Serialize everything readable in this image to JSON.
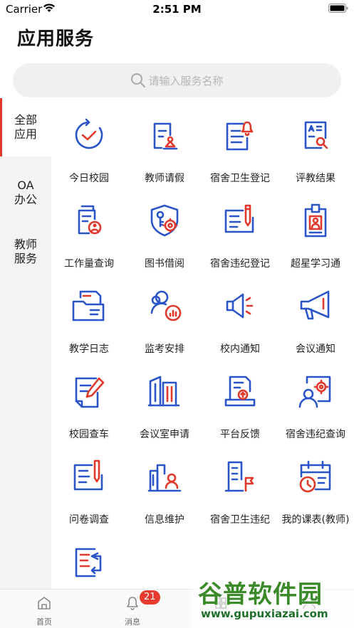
{
  "status_bar": {
    "carrier": "Carrier",
    "time": "2:51 PM"
  },
  "page_title": "应用服务",
  "search": {
    "placeholder": "请输入服务名称"
  },
  "sidebar": {
    "items": [
      {
        "label": "全部\n应用",
        "active": true
      },
      {
        "label": "OA\n办公",
        "active": false
      },
      {
        "label": "教师\n服务",
        "active": false
      }
    ]
  },
  "services": [
    {
      "label": "今日校园",
      "icon": "clock-check-icon"
    },
    {
      "label": "教师请假",
      "icon": "leave-request-icon"
    },
    {
      "label": "宿舍卫生登记",
      "icon": "hygiene-bell-icon"
    },
    {
      "label": "评教结果",
      "icon": "evaluation-result-icon"
    },
    {
      "label": "工作量查询",
      "icon": "workload-files-icon"
    },
    {
      "label": "图书借阅",
      "icon": "book-key-shield-icon"
    },
    {
      "label": "宿舍违纪登记",
      "icon": "discipline-pen-icon"
    },
    {
      "label": "超星学习通",
      "icon": "id-badge-icon"
    },
    {
      "label": "教学日志",
      "icon": "folder-log-icon"
    },
    {
      "label": "监考安排",
      "icon": "proctor-users-icon"
    },
    {
      "label": "校内通知",
      "icon": "speaker-icon"
    },
    {
      "label": "会议通知",
      "icon": "megaphone-icon"
    },
    {
      "label": "校园查车",
      "icon": "edit-document-icon"
    },
    {
      "label": "会议室申请",
      "icon": "buildings-icon"
    },
    {
      "label": "平台反馈",
      "icon": "feedback-upload-icon"
    },
    {
      "label": "宿舍违纪查询",
      "icon": "user-gear-icon"
    },
    {
      "label": "问卷调查",
      "icon": "questionnaire-icon"
    },
    {
      "label": "信息维护",
      "icon": "city-user-icon"
    },
    {
      "label": "宿舍卫生违纪",
      "icon": "building-flag-icon"
    },
    {
      "label": "我的课表(教师)",
      "icon": "calendar-clock-icon"
    },
    {
      "label": "",
      "icon": "list-arrows-icon"
    }
  ],
  "tabbar": {
    "items": [
      {
        "label": "首页",
        "icon": "home-icon"
      },
      {
        "label": "消息",
        "icon": "bell-icon",
        "badge": "21"
      },
      {
        "label": "",
        "icon": "service-icon"
      },
      {
        "label": "",
        "icon": "profile-icon"
      }
    ]
  },
  "watermark": {
    "main": "谷普软件园",
    "url": "www.gupuxiazai.com"
  },
  "colors": {
    "icon_blue": "#2a55c9",
    "icon_red": "#e0392b",
    "accent": "#e0392b"
  }
}
